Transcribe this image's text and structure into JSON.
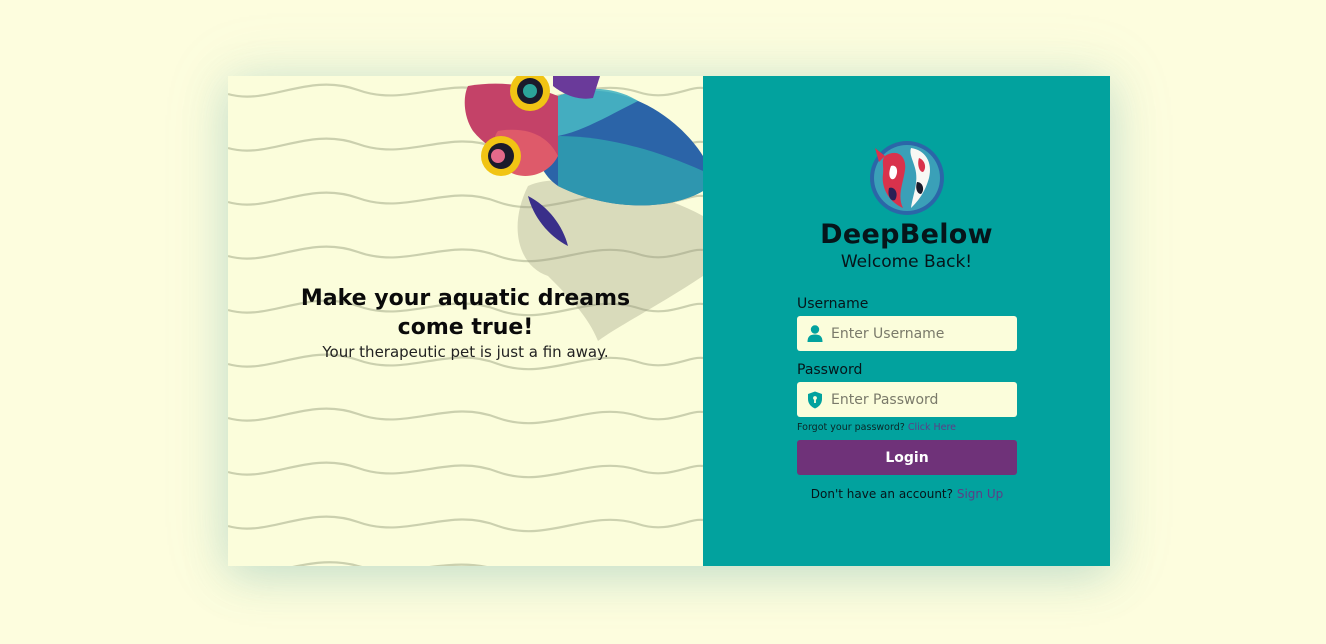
{
  "hero": {
    "title": "Make your aquatic dreams come true!",
    "subtitle": "Your therapeutic pet is just a fin away."
  },
  "brand": {
    "name": "DeepBelow",
    "welcome": "Welcome Back!"
  },
  "form": {
    "username_label": "Username",
    "username_placeholder": "Enter Username",
    "password_label": "Password",
    "password_placeholder": "Enter Password",
    "forgot_text": "Forgot your password?",
    "forgot_link": "Click Here",
    "login_label": "Login",
    "signup_text": "Don't have an account?",
    "signup_link": "Sign Up"
  },
  "icons": {
    "username": "user-icon",
    "password": "shield-icon",
    "logo": "koi-fish-logo"
  },
  "colors": {
    "page_bg": "#fdfdde",
    "panel_teal": "#02a29e",
    "button_purple": "#6f3279",
    "link_purple": "#5d3d86"
  }
}
